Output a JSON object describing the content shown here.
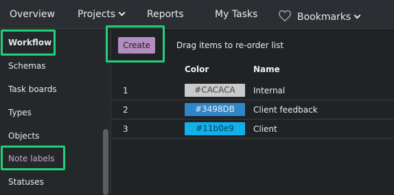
{
  "nav": {
    "overview": "Overview",
    "projects": "Projects",
    "reports": "Reports",
    "my_tasks": "My Tasks",
    "bookmarks": "Bookmarks"
  },
  "sidebar": {
    "items": [
      {
        "label": "Workflow"
      },
      {
        "label": "Schemas"
      },
      {
        "label": "Task boards"
      },
      {
        "label": "Types"
      },
      {
        "label": "Objects"
      },
      {
        "label": "Note labels"
      },
      {
        "label": "Statuses"
      }
    ]
  },
  "toolbar": {
    "create_label": "Create",
    "hint": "Drag items to re-order list"
  },
  "table": {
    "headers": {
      "color": "Color",
      "name": "Name"
    },
    "rows": [
      {
        "num": "1",
        "color_label": "#CACACA",
        "color": "#CACACA",
        "text_color": "#444444",
        "name": "Internal"
      },
      {
        "num": "2",
        "color_label": "#3498DB",
        "color": "#2f86c8",
        "text_color": "#e8eef4",
        "name": "Client feedback"
      },
      {
        "num": "3",
        "color_label": "#11b0e9",
        "color": "#11b0e9",
        "text_color": "#0d3d52",
        "name": "Client"
      }
    ]
  }
}
